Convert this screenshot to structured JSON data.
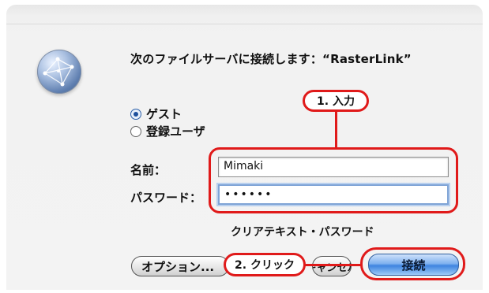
{
  "dialog": {
    "server_message": "次のファイルサーバに接続します：“RasterLink”",
    "options": [
      {
        "label": "ゲスト",
        "selected": true
      },
      {
        "label": "登録ユーザ",
        "selected": false
      }
    ],
    "name_label": "名前：",
    "name_value": "Mimaki",
    "password_label": "パスワード：",
    "password_value": "••••••",
    "note": "クリアテキスト・パスワード",
    "buttons": {
      "options": "オプション...",
      "cancel": "キャンセル",
      "connect": "接続"
    }
  },
  "annotations": {
    "step1": "1. 入力",
    "step2": "2. クリック"
  },
  "colors": {
    "annotation_red": "#e01a1a",
    "default_button_blue": "#3f84e0"
  },
  "icons": {
    "server": "network-globe-icon"
  }
}
